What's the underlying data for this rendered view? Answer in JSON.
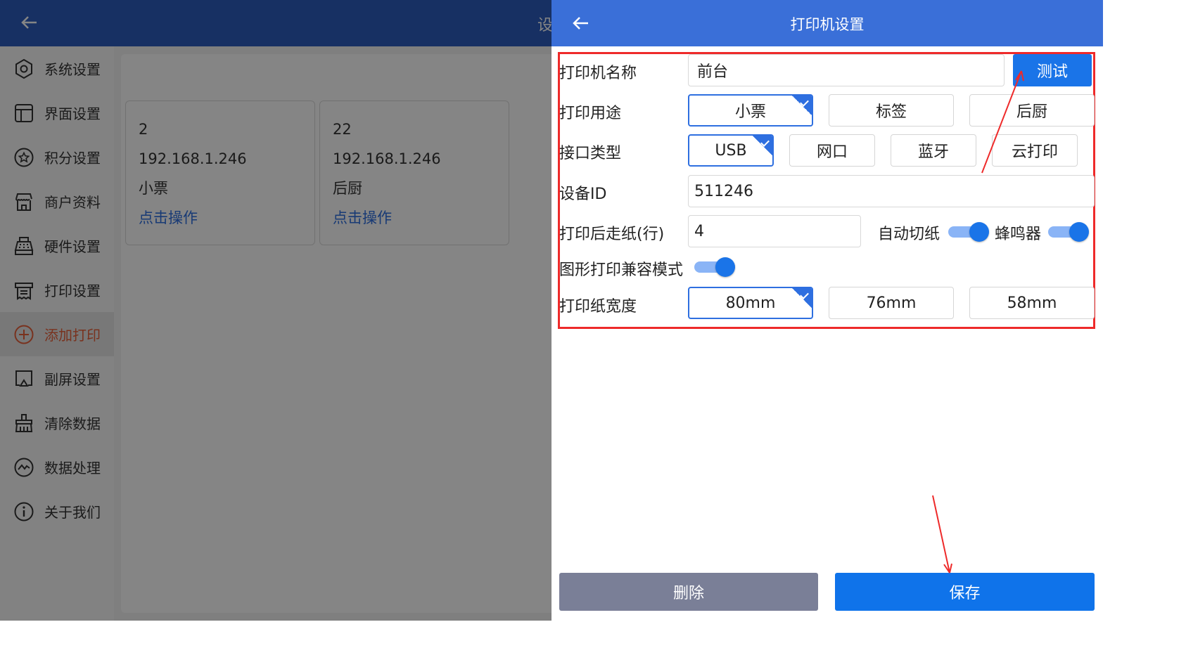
{
  "background": {
    "header_title": "设",
    "sidebar": {
      "items": [
        {
          "label": "系统设置",
          "icon": "hexagon-settings-icon"
        },
        {
          "label": "界面设置",
          "icon": "layout-icon"
        },
        {
          "label": "积分设置",
          "icon": "star-circle-icon"
        },
        {
          "label": "商户资料",
          "icon": "store-icon"
        },
        {
          "label": "硬件设置",
          "icon": "cash-register-icon"
        },
        {
          "label": "打印设置",
          "icon": "printer-icon"
        },
        {
          "label": "添加打印",
          "icon": "plus-circle-icon",
          "active": true
        },
        {
          "label": "副屏设置",
          "icon": "cast-screen-icon"
        },
        {
          "label": "清除数据",
          "icon": "broom-icon"
        },
        {
          "label": "数据处理",
          "icon": "chart-circle-icon"
        },
        {
          "label": "关于我们",
          "icon": "info-circle-icon"
        }
      ]
    },
    "printers": [
      {
        "name": "2",
        "ip": "192.168.1.246",
        "usage": "小票",
        "action": "点击操作"
      },
      {
        "name": "22",
        "ip": "192.168.1.246",
        "usage": "后厨",
        "action": "点击操作"
      }
    ]
  },
  "panel": {
    "title": "打印机设置",
    "fields": {
      "name_label": "打印机名称",
      "name_value": "前台",
      "test_button": "测试",
      "usage_label": "打印用途",
      "usage_options": [
        "小票",
        "标签",
        "后厨"
      ],
      "interface_label": "接口类型",
      "interface_options": [
        "USB",
        "网口",
        "蓝牙",
        "云打印"
      ],
      "device_id_label": "设备ID",
      "device_id_value": "511246",
      "feed_label": "打印后走纸(行)",
      "feed_value": "4",
      "auto_cut_label": "自动切纸",
      "buzzer_label": "蜂鸣器",
      "graphic_mode_label": "图形打印兼容模式",
      "paper_width_label": "打印纸宽度",
      "paper_width_options": [
        "80mm",
        "76mm",
        "58mm"
      ]
    },
    "delete_button": "删除",
    "save_button": "保存",
    "colors": {
      "primary": "#1a74e8",
      "header": "#3a6fd8",
      "highlight": "#ee2a2a"
    }
  }
}
